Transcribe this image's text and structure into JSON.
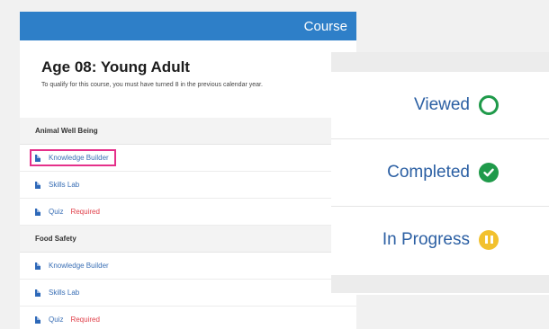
{
  "course": {
    "header_label": "Course",
    "title": "Age 08: Young Adult",
    "description": "To qualify for this course, you must have turned 8 in the previous calendar year.",
    "sections": [
      {
        "name": "Animal Well Being",
        "items": [
          {
            "label": "Knowledge Builder",
            "required": "",
            "highlighted": true
          },
          {
            "label": "Skills Lab",
            "required": "",
            "highlighted": false
          },
          {
            "label": "Quiz",
            "required": "Required",
            "highlighted": false
          }
        ]
      },
      {
        "name": "Food Safety",
        "items": [
          {
            "label": "Knowledge Builder",
            "required": "",
            "highlighted": false
          },
          {
            "label": "Skills Lab",
            "required": "",
            "highlighted": false
          },
          {
            "label": "Quiz",
            "required": "Required",
            "highlighted": false
          }
        ]
      }
    ]
  },
  "legend": {
    "viewed": "Viewed",
    "completed": "Completed",
    "in_progress": "In Progress"
  },
  "colors": {
    "header_blue": "#2e7fc8",
    "status_green": "#1f9a4a",
    "status_yellow": "#f2c12e",
    "required_red": "#e0404a",
    "highlight_pink": "#e5308a"
  },
  "icons": {
    "item": "document-icon",
    "viewed": "empty-circle-icon",
    "completed": "check-circle-icon",
    "in_progress": "pause-circle-icon"
  }
}
